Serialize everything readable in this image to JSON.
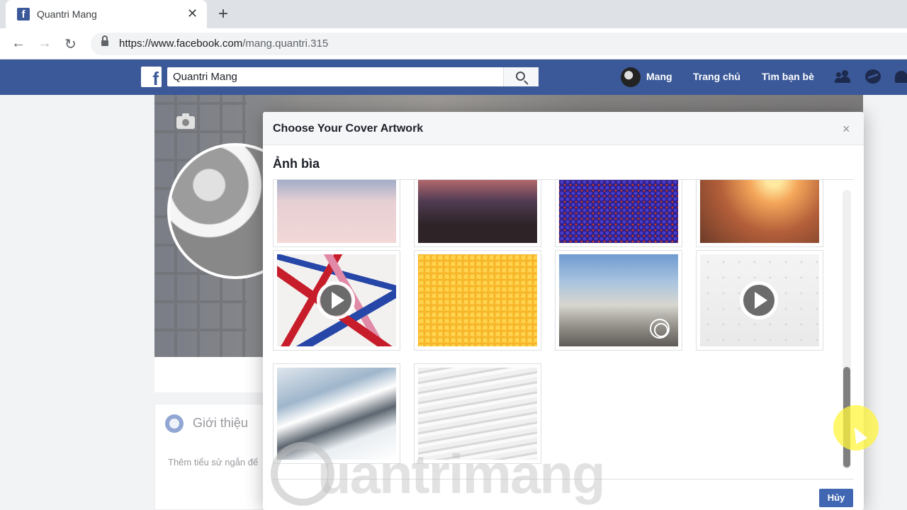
{
  "browser": {
    "tab_title": "Quantri Mang",
    "new_tab": "+",
    "close_tab": "✕",
    "url_host": "https://www.facebook.com",
    "url_path": "/mang.quantri.315"
  },
  "facebook": {
    "logo": "f",
    "search_value": "Quantri Mang",
    "nav": {
      "profile_name": "Mang",
      "home": "Trang chủ",
      "find_friends": "Tìm bạn bè"
    }
  },
  "profile": {
    "intro_title": "Giới thiệu",
    "intro_text": "Thêm tiểu sử ngắn để"
  },
  "dialog": {
    "title": "Choose Your Cover Artwork",
    "close": "×",
    "section_title": "Ảnh bìa",
    "cancel_label": "Hủy",
    "artworks": [
      {
        "kind": "image",
        "icon": null
      },
      {
        "kind": "image",
        "icon": null
      },
      {
        "kind": "image",
        "icon": null
      },
      {
        "kind": "image",
        "icon": null
      },
      {
        "kind": "video",
        "icon": "play-icon"
      },
      {
        "kind": "image",
        "icon": null
      },
      {
        "kind": "360",
        "icon": "view-360-icon"
      },
      {
        "kind": "video",
        "icon": "play-icon"
      },
      {
        "kind": "image",
        "icon": null
      },
      {
        "kind": "image",
        "icon": null
      }
    ]
  },
  "watermark": "uantrimang"
}
